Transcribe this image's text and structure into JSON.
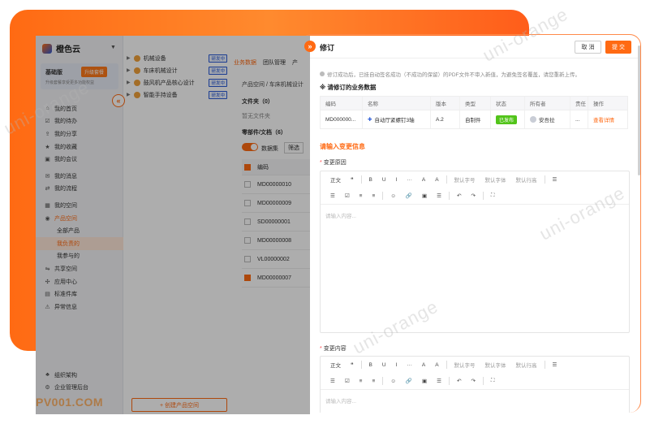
{
  "app": {
    "logo_text": "橙色云",
    "plan": {
      "name": "基础版",
      "upgrade_label": "升级套餐",
      "desc": "升级套餐享受更多功能权益"
    },
    "nav": [
      {
        "label": "我的首页",
        "icon": "home-icon"
      },
      {
        "label": "我的待办",
        "icon": "todo-icon"
      },
      {
        "label": "我的分享",
        "icon": "share-icon"
      },
      {
        "label": "我的收藏",
        "icon": "star-icon"
      },
      {
        "label": "我的会议",
        "icon": "meeting-icon"
      },
      {
        "label": "我的消息",
        "icon": "message-icon"
      },
      {
        "label": "我的流程",
        "icon": "flow-icon"
      },
      {
        "label": "我的空间",
        "icon": "space-icon"
      },
      {
        "label": "产品空间",
        "icon": "product-icon"
      },
      {
        "label": "全部产品",
        "icon": ""
      },
      {
        "label": "我负责的",
        "icon": ""
      },
      {
        "label": "我参与的",
        "icon": ""
      },
      {
        "label": "共享空间",
        "icon": "shared-icon"
      },
      {
        "label": "应用中心",
        "icon": "apps-icon"
      },
      {
        "label": "标准件库",
        "icon": "library-icon"
      },
      {
        "label": "异常信息",
        "icon": "warning-icon"
      }
    ],
    "nav_bottom": [
      {
        "label": "组织架构",
        "icon": "org-icon"
      },
      {
        "label": "企业管理后台",
        "icon": "admin-icon"
      }
    ],
    "tree": [
      {
        "label": "机械设备",
        "tag": "研发中"
      },
      {
        "label": "车床机械设计",
        "tag": "研发中"
      },
      {
        "label": "鼓风机产品核心设计",
        "tag": "研发中"
      },
      {
        "label": "智能手持设备",
        "tag": "研发中"
      }
    ],
    "create_label": "+ 创建产品空间",
    "tabs": [
      "业务数据",
      "团队管理",
      "产"
    ],
    "breadcrumb": "产品空间 / 车床机械设计",
    "folder_label": "文件夹（0）",
    "no_folder": "暂无文件夹",
    "parts_label": "零部件/文档（6）",
    "toggle_label": "数据集",
    "chip_label": "筛选",
    "table_head": "编码",
    "table_rows": [
      "MD00000010",
      "MD00000009",
      "SD00000001",
      "MD00000008",
      "VL00000002",
      "MD00000007"
    ],
    "brand": "PV001.COM"
  },
  "drawer": {
    "title": "修订",
    "cancel_label": "取 消",
    "submit_label": "提 交",
    "notice": "修订成功后，已挂自动签名成功（不成功的保留）的PDF文件不审入新值，为避免签名覆盖，请您重新上传。",
    "section_biz": "※ 请修订的业务数据",
    "columns": [
      "编码",
      "名称",
      "版本",
      "类型",
      "状态",
      "所有者",
      "责任",
      "操作"
    ],
    "row": {
      "code": "MD000000...",
      "name": "自动厅紧螺钉3轴",
      "version": "A.2",
      "type": "自制件",
      "status": "已发布",
      "owner": "安吾拉",
      "resp": "...",
      "action": "查看详情"
    },
    "section_change": "请输入变更信息",
    "reason_label": "变更原因",
    "content_label": "变更内容",
    "toolbar": {
      "row1": [
        "正文",
        "❝",
        "B",
        "U",
        "I",
        "···",
        "A",
        "A",
        "默认字号",
        "默认字体",
        "默认行高",
        "☰"
      ],
      "row2": [
        "☰",
        "☑",
        "≡",
        "≡",
        "☺",
        "🔗",
        "▣",
        "☰",
        "↶",
        "↷",
        "⛶"
      ]
    },
    "placeholder": "请输入内容..."
  },
  "watermark": "uni-orange",
  "colors": {
    "accent": "#ff6a13",
    "success": "#52c41a",
    "tag_blue": "#2a5bd7"
  }
}
